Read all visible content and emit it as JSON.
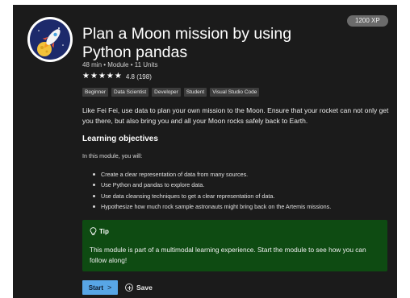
{
  "module": {
    "xp": "1200 XP",
    "logo_icon": "rocket-moon-icon",
    "title": "Plan a Moon mission by using Python pandas",
    "meta": "48 min • Module • 11 Units",
    "rating": {
      "score": 4.8,
      "stars": 5,
      "text": "4.8 (198)"
    },
    "tags": [
      "Beginner",
      "Data Scientist",
      "Developer",
      "Student",
      "Visual Studio Code"
    ],
    "description": "Like Fei Fei, use data to plan your own mission to the Moon. Ensure that your rocket can not only get you there, but also bring you and all your Moon rocks safely back to Earth."
  },
  "learning_objectives": {
    "heading": "Learning objectives",
    "intro": "In this module, you will:",
    "items": [
      "Create a clear representation of data from many sources.",
      "Use Python and pandas to explore data.",
      "Use data cleansing techniques to get a clear representation of data.",
      "Hypothesize how much rock sample astronauts might bring back on the Artemis missions."
    ]
  },
  "tip": {
    "icon": "lightbulb-icon",
    "title": "Tip",
    "text": "This module is part of a multimodal learning experience. Start the module to see how you can follow along!"
  },
  "actions": {
    "start_label": "Start",
    "start_chevron": ">",
    "save_label": "Save",
    "save_icon": "add-circle-icon"
  },
  "colors": {
    "panel_bg": "#1b1b1b",
    "tip_bg": "#0e4b12",
    "start_button": "#58a6e6"
  }
}
